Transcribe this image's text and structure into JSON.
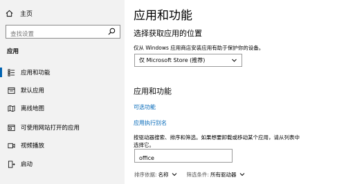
{
  "sidebar": {
    "home_label": "主页",
    "search_placeholder": "查找设置",
    "section_label": "应用",
    "items": [
      {
        "label": "应用和功能",
        "icon": "apps-list-icon",
        "selected": true
      },
      {
        "label": "默认应用",
        "icon": "default-apps-icon",
        "selected": false
      },
      {
        "label": "离线地图",
        "icon": "offline-maps-icon",
        "selected": false
      },
      {
        "label": "可使用网站打开的应用",
        "icon": "apps-for-websites-icon",
        "selected": false
      },
      {
        "label": "视频播放",
        "icon": "video-playback-icon",
        "selected": false
      },
      {
        "label": "启动",
        "icon": "startup-icon",
        "selected": false
      }
    ]
  },
  "main": {
    "title": "应用和功能",
    "install_heading": "选择获取应用的位置",
    "install_desc": "仅从 Windows 应用商店安装应用有助于保护你的设备。",
    "install_dropdown_value": "仅 Microsoft Store (推荐)",
    "apps_heading": "应用和功能",
    "optional_features_link": "可选功能",
    "app_aliases_link": "应用执行别名",
    "search_desc_line1": "按驱动器搜索、排序和筛选。如果想要卸载或移动某个应用，请从列表中",
    "search_desc_line2": "选择它。",
    "search_value": "office",
    "sort_label": "排序依据:",
    "sort_value": "名称",
    "filter_label": "筛选条件:",
    "filter_value": "所有驱动器"
  },
  "colors": {
    "accent": "#0063b1",
    "link": "#0067b8",
    "sidebar_bg": "#f2f2f2"
  }
}
